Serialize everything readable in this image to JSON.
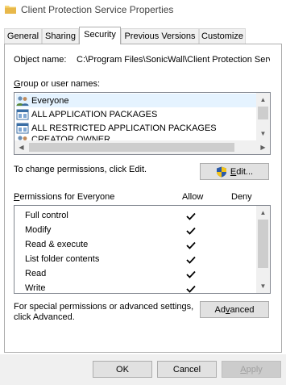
{
  "window": {
    "title": "Client Protection Service Properties",
    "icon": "folder-icon"
  },
  "tabs": [
    {
      "label": "General",
      "active": false
    },
    {
      "label": "Sharing",
      "active": false
    },
    {
      "label": "Security",
      "active": true
    },
    {
      "label": "Previous Versions",
      "active": false
    },
    {
      "label": "Customize",
      "active": false
    }
  ],
  "object": {
    "label": "Object name:",
    "value": "C:\\Program Files\\SonicWall\\Client Protection Servi"
  },
  "groups": {
    "label_prefix": "",
    "label_access": "G",
    "label_rest": "roup or user names:",
    "items": [
      {
        "label": "Everyone",
        "icon": "users-icon",
        "selected": true
      },
      {
        "label": "ALL APPLICATION PACKAGES",
        "icon": "package-icon",
        "selected": false
      },
      {
        "label": "ALL RESTRICTED APPLICATION PACKAGES",
        "icon": "package-icon",
        "selected": false
      },
      {
        "label": "CREATOR OWNER",
        "icon": "users-icon",
        "selected": false
      }
    ]
  },
  "change_perm_text": "To change permissions, click Edit.",
  "edit_button": {
    "access": "E",
    "rest": "dit...",
    "icon": "shield-icon"
  },
  "permissions": {
    "label_access": "P",
    "label_rest": "ermissions for Everyone",
    "allow_header": "Allow",
    "deny_header": "Deny",
    "rows": [
      {
        "label": "Full control",
        "allow": true,
        "deny": false
      },
      {
        "label": "Modify",
        "allow": true,
        "deny": false
      },
      {
        "label": "Read & execute",
        "allow": true,
        "deny": false
      },
      {
        "label": "List folder contents",
        "allow": true,
        "deny": false
      },
      {
        "label": "Read",
        "allow": true,
        "deny": false
      },
      {
        "label": "Write",
        "allow": true,
        "deny": false
      }
    ]
  },
  "advanced": {
    "text_line1": "For special permissions or advanced settings,",
    "text_line2": "click Advanced.",
    "button_prefix": "Ad",
    "button_access": "v",
    "button_rest": "anced"
  },
  "footer": {
    "ok": "OK",
    "cancel": "Cancel",
    "apply_access": "A",
    "apply_rest": "pply",
    "apply_enabled": false
  },
  "colors": {
    "selection": "#e5f3ff",
    "button": "#e1e1e1",
    "border": "#adadad"
  }
}
